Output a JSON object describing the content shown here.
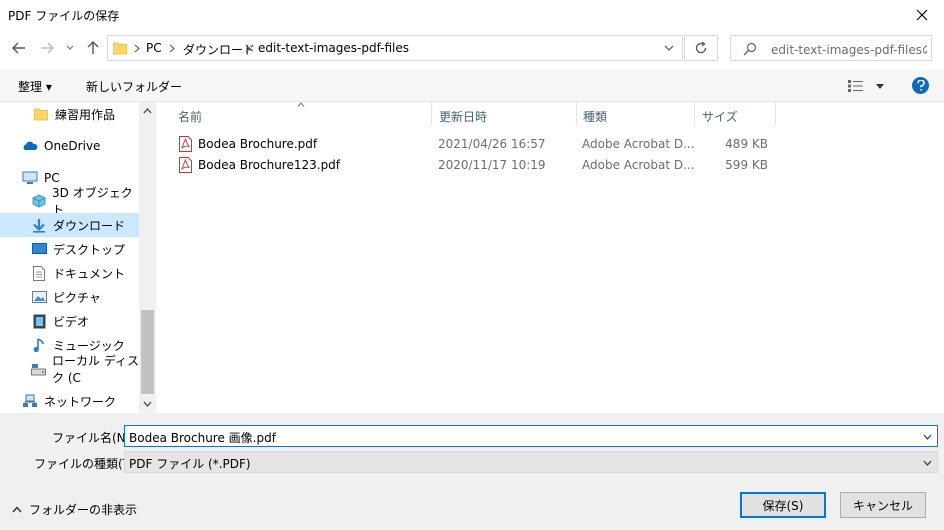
{
  "window": {
    "title": "PDF ファイルの保存"
  },
  "address": {
    "crumbs": [
      "PC",
      "ダウンロード",
      "edit-text-images-pdf-files"
    ]
  },
  "search": {
    "placeholder": "edit-text-images-pdf-filesの..."
  },
  "toolbar": {
    "organize_label": "整理 ▾",
    "new_folder_label": "新しいフォルダー"
  },
  "sidebar": {
    "items": [
      {
        "label": "練習用作品",
        "icon": "folder-icon"
      },
      {
        "label": "OneDrive",
        "icon": "cloud-icon"
      },
      {
        "label": "PC",
        "icon": "computer-icon"
      },
      {
        "label": "3D オブジェクト",
        "icon": "cube-icon"
      },
      {
        "label": "ダウンロード",
        "icon": "download-icon"
      },
      {
        "label": "デスクトップ",
        "icon": "desktop-icon"
      },
      {
        "label": "ドキュメント",
        "icon": "document-icon"
      },
      {
        "label": "ピクチャ",
        "icon": "picture-icon"
      },
      {
        "label": "ビデオ",
        "icon": "video-icon"
      },
      {
        "label": "ミュージック",
        "icon": "music-icon"
      },
      {
        "label": "ローカル ディスク (C",
        "icon": "disk-icon"
      },
      {
        "label": "ネットワーク",
        "icon": "network-icon"
      }
    ],
    "selected": "ダウンロード"
  },
  "filelist": {
    "columns": [
      "名前",
      "更新日時",
      "種類",
      "サイズ"
    ],
    "rows": [
      {
        "name": "Bodea Brochure.pdf",
        "date": "2021/04/26 16:57",
        "type": "Adobe Acrobat D...",
        "size": "489 KB"
      },
      {
        "name": "Bodea Brochure123.pdf",
        "date": "2020/11/17 10:19",
        "type": "Adobe Acrobat D...",
        "size": "599 KB"
      }
    ]
  },
  "form": {
    "filename_label": "ファイル名(N):",
    "filename_value": "Bodea Brochure 画像.pdf",
    "filetype_label": "ファイルの種類(T):",
    "filetype_value": "PDF ファイル (*.PDF)"
  },
  "footer": {
    "hide_folders_label": "フォルダーの非表示",
    "save_label": "保存(S)",
    "cancel_label": "キャンセル"
  },
  "colors": {
    "accent": "#0078d7",
    "selected_bg": "#cce8ff",
    "pdf_red": "#d32f2f",
    "folder_yellow": "#ffd766"
  }
}
